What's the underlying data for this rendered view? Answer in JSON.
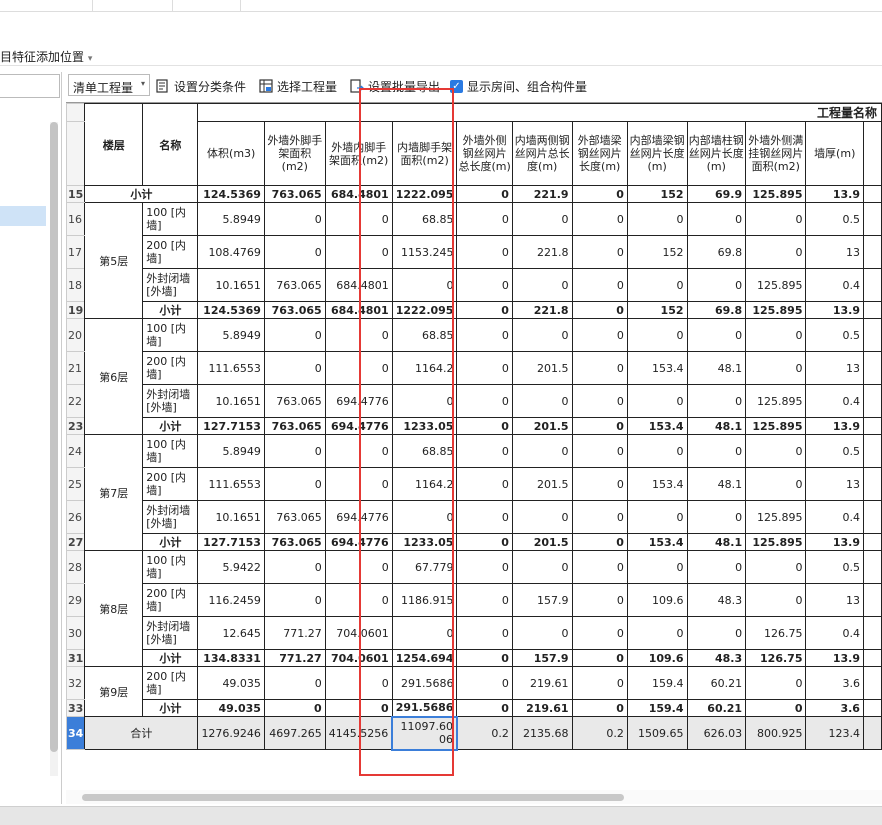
{
  "menu": {
    "add_feature_position": "目特征添加位置",
    "arrow": "▾"
  },
  "toolbar": {
    "select_value": "清单工程量",
    "select_arrow": "▾",
    "set_classify": "设置分类条件",
    "select_project": "选择工程量",
    "set_batch_export": "设置批量导出",
    "show_rooms": "显示房间、组合构件量",
    "show_rooms_checked": true
  },
  "grid": {
    "group_title": "工程量名称",
    "headers": {
      "floor": "楼层",
      "name": "名称",
      "cols": [
        "体积(m3)",
        "外墙外脚手架面积(m2)",
        "外墙内脚手架面积(m2)",
        "内墙脚手架面积(m2)",
        "外墙外侧钢丝网片总长度(m)",
        "内墙两侧钢丝网片总长度(m)",
        "外部墙梁钢丝网片长度(m)",
        "内部墙梁钢丝网片长度(m)",
        "内部墙柱钢丝网片长度(m)",
        "外墙外侧满挂钢丝网片面积(m2)",
        "墙厚(m)"
      ]
    },
    "rows": [
      {
        "rn": "15",
        "type": "sub",
        "floor": "",
        "name": "小计",
        "vals": [
          "124.5369",
          "763.065",
          "684.4801",
          "1222.095",
          "0",
          "221.9",
          "0",
          "152",
          "69.9",
          "125.895",
          "13.9"
        ]
      },
      {
        "rn": "16",
        "type": "item",
        "floor": "第5层",
        "name": "100 [内墙]",
        "vals": [
          "5.8949",
          "0",
          "0",
          "68.85",
          "0",
          "0",
          "0",
          "0",
          "0",
          "0",
          "0.5"
        ]
      },
      {
        "rn": "17",
        "type": "item",
        "floor": "",
        "name": "200 [内墙]",
        "vals": [
          "108.4769",
          "0",
          "0",
          "1153.245",
          "0",
          "221.8",
          "0",
          "152",
          "69.8",
          "0",
          "13"
        ]
      },
      {
        "rn": "18",
        "type": "item",
        "floor": "",
        "name": "外封闭墙 [外墙]",
        "vals": [
          "10.1651",
          "763.065",
          "684.4801",
          "0",
          "0",
          "0",
          "0",
          "0",
          "0",
          "125.895",
          "0.4"
        ]
      },
      {
        "rn": "19",
        "type": "sub",
        "floor": "",
        "name": "小计",
        "vals": [
          "124.5369",
          "763.065",
          "684.4801",
          "1222.095",
          "0",
          "221.8",
          "0",
          "152",
          "69.8",
          "125.895",
          "13.9"
        ]
      },
      {
        "rn": "20",
        "type": "item",
        "floor": "第6层",
        "name": "100 [内墙]",
        "vals": [
          "5.8949",
          "0",
          "0",
          "68.85",
          "0",
          "0",
          "0",
          "0",
          "0",
          "0",
          "0.5"
        ]
      },
      {
        "rn": "21",
        "type": "item",
        "floor": "",
        "name": "200 [内墙]",
        "vals": [
          "111.6553",
          "0",
          "0",
          "1164.2",
          "0",
          "201.5",
          "0",
          "153.4",
          "48.1",
          "0",
          "13"
        ]
      },
      {
        "rn": "22",
        "type": "item",
        "floor": "",
        "name": "外封闭墙 [外墙]",
        "vals": [
          "10.1651",
          "763.065",
          "694.4776",
          "0",
          "0",
          "0",
          "0",
          "0",
          "0",
          "125.895",
          "0.4"
        ]
      },
      {
        "rn": "23",
        "type": "sub",
        "floor": "",
        "name": "小计",
        "vals": [
          "127.7153",
          "763.065",
          "694.4776",
          "1233.05",
          "0",
          "201.5",
          "0",
          "153.4",
          "48.1",
          "125.895",
          "13.9"
        ]
      },
      {
        "rn": "24",
        "type": "item",
        "floor": "第7层",
        "name": "100 [内墙]",
        "vals": [
          "5.8949",
          "0",
          "0",
          "68.85",
          "0",
          "0",
          "0",
          "0",
          "0",
          "0",
          "0.5"
        ]
      },
      {
        "rn": "25",
        "type": "item",
        "floor": "",
        "name": "200 [内墙]",
        "vals": [
          "111.6553",
          "0",
          "0",
          "1164.2",
          "0",
          "201.5",
          "0",
          "153.4",
          "48.1",
          "0",
          "13"
        ]
      },
      {
        "rn": "26",
        "type": "item",
        "floor": "",
        "name": "外封闭墙 [外墙]",
        "vals": [
          "10.1651",
          "763.065",
          "694.4776",
          "0",
          "0",
          "0",
          "0",
          "0",
          "0",
          "125.895",
          "0.4"
        ]
      },
      {
        "rn": "27",
        "type": "sub",
        "floor": "",
        "name": "小计",
        "vals": [
          "127.7153",
          "763.065",
          "694.4776",
          "1233.05",
          "0",
          "201.5",
          "0",
          "153.4",
          "48.1",
          "125.895",
          "13.9"
        ]
      },
      {
        "rn": "28",
        "type": "item",
        "floor": "第8层",
        "name": "100 [内墙]",
        "vals": [
          "5.9422",
          "0",
          "0",
          "67.779",
          "0",
          "0",
          "0",
          "0",
          "0",
          "0",
          "0.5"
        ]
      },
      {
        "rn": "29",
        "type": "item",
        "floor": "",
        "name": "200 [内墙]",
        "vals": [
          "116.2459",
          "0",
          "0",
          "1186.915",
          "0",
          "157.9",
          "0",
          "109.6",
          "48.3",
          "0",
          "13"
        ]
      },
      {
        "rn": "30",
        "type": "item",
        "floor": "",
        "name": "外封闭墙 [外墙]",
        "vals": [
          "12.645",
          "771.27",
          "704.0601",
          "0",
          "0",
          "0",
          "0",
          "0",
          "0",
          "126.75",
          "0.4"
        ]
      },
      {
        "rn": "31",
        "type": "sub",
        "floor": "",
        "name": "小计",
        "vals": [
          "134.8331",
          "771.27",
          "704.0601",
          "1254.694",
          "0",
          "157.9",
          "0",
          "109.6",
          "48.3",
          "126.75",
          "13.9"
        ]
      },
      {
        "rn": "32",
        "type": "item",
        "floor": "第9层",
        "name": "200 [内墙]",
        "vals": [
          "49.035",
          "0",
          "0",
          "291.5686",
          "0",
          "219.61",
          "0",
          "159.4",
          "60.21",
          "0",
          "3.6"
        ]
      },
      {
        "rn": "33",
        "type": "sub",
        "floor": "",
        "name": "小计",
        "vals": [
          "49.035",
          "0",
          "0",
          "291.5686",
          "0",
          "219.61",
          "0",
          "159.4",
          "60.21",
          "0",
          "3.6"
        ]
      }
    ],
    "total": {
      "rn": "34",
      "label": "合计",
      "vals": [
        "1276.9246",
        "4697.265",
        "4145.5256",
        "11097.6006",
        "0.2",
        "2135.68",
        "0.2",
        "1509.65",
        "626.03",
        "800.925",
        "123.4"
      ]
    }
  }
}
